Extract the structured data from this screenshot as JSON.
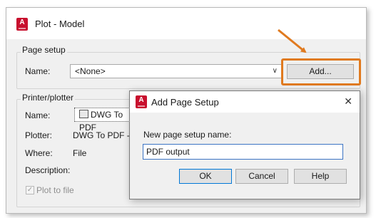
{
  "colors": {
    "accent_orange": "#e07a1f",
    "app_icon_red": "#c8102e",
    "input_focus_blue": "#3c74c4"
  },
  "main_window": {
    "app_icon_letter": "A",
    "title": "Plot - Model",
    "page_setup": {
      "group_label": "Page setup",
      "name_label": "Name:",
      "name_value": "<None>",
      "add_button": "Add..."
    },
    "printer": {
      "group_label": "Printer/plotter",
      "name_label": "Name:",
      "name_value": "DWG To PDF",
      "plotter_label": "Plotter:",
      "plotter_value": "DWG To PDF - PD",
      "where_label": "Where:",
      "where_value": "File",
      "description_label": "Description:",
      "plot_to_file_label": "Plot to file",
      "plot_to_file_checked": true
    }
  },
  "dialog": {
    "app_icon_letter": "A",
    "title": "Add Page Setup",
    "close_glyph": "✕",
    "field_label": "New page setup name:",
    "field_value": "PDF output",
    "ok_button": "OK",
    "cancel_button": "Cancel",
    "help_button": "Help"
  }
}
